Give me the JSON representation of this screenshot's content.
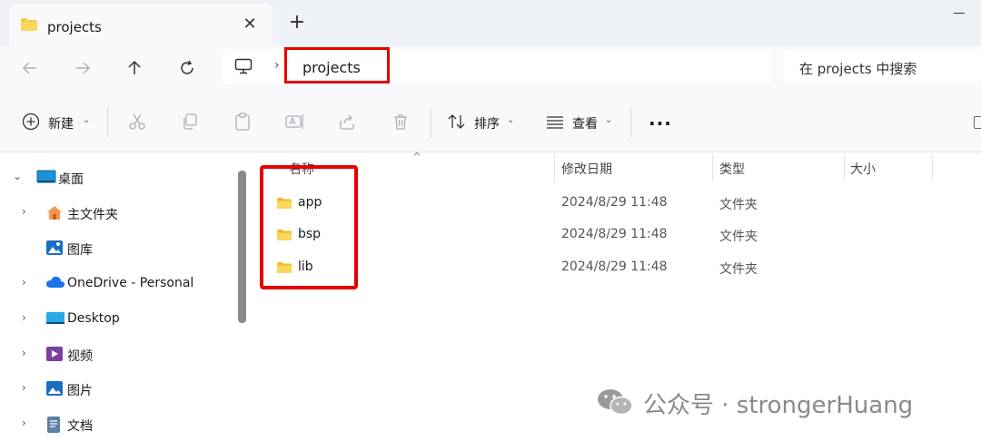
{
  "window": {
    "tab_title": "projects",
    "tab_close": "✕",
    "new_tab": "+"
  },
  "nav": {
    "breadcrumb": "projects",
    "chevron": "›",
    "search_placeholder": "在 projects 中搜索"
  },
  "toolbar": {
    "new_label": "新建",
    "sort_label": "排序",
    "view_label": "查看",
    "more_label": "···",
    "caret": "⌄"
  },
  "sidebar": {
    "items": [
      {
        "label": "桌面",
        "icon": "desktop-icon",
        "expanded": true
      },
      {
        "label": "主文件夹",
        "icon": "home-icon"
      },
      {
        "label": "图库",
        "icon": "gallery-icon"
      },
      {
        "label": "OneDrive - Personal",
        "icon": "onedrive-icon"
      },
      {
        "label": "Desktop",
        "icon": "desktop-folder-icon"
      },
      {
        "label": "视频",
        "icon": "videos-icon"
      },
      {
        "label": "图片",
        "icon": "pictures-icon"
      },
      {
        "label": "文档",
        "icon": "documents-icon"
      }
    ]
  },
  "columns": {
    "name": "名称",
    "modified": "修改日期",
    "type": "类型",
    "size": "大小"
  },
  "files": [
    {
      "name": "app",
      "modified": "2024/8/29 11:48",
      "type": "文件夹"
    },
    {
      "name": "bsp",
      "modified": "2024/8/29 11:48",
      "type": "文件夹"
    },
    {
      "name": "lib",
      "modified": "2024/8/29 11:48",
      "type": "文件夹"
    }
  ],
  "watermark": {
    "text": "公众号 · strongerHuang"
  },
  "colors": {
    "highlight": "#e60000",
    "folder": "#f7c948",
    "chrome_bg": "#f7f9fb",
    "titlebar_bg": "#eef2f6"
  }
}
